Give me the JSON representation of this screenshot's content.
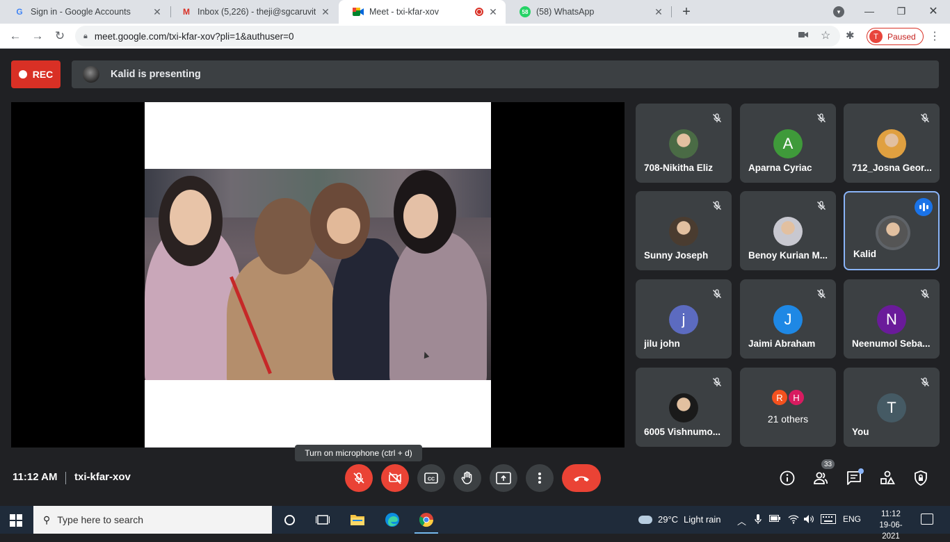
{
  "browser": {
    "tabs": [
      {
        "title": "Sign in - Google Accounts",
        "favicon": "G",
        "active": false
      },
      {
        "title": "Inbox (5,226) - theji@sgcaruvithu",
        "favicon": "M",
        "active": false
      },
      {
        "title": "Meet - txi-kfar-xov",
        "favicon": "meet",
        "active": true,
        "recording": true
      },
      {
        "title": "(58) WhatsApp",
        "favicon": "58",
        "active": false
      }
    ],
    "url": "meet.google.com/txi-kfar-xov?pli=1&authuser=0",
    "profile": {
      "initial": "T",
      "label": "Paused"
    }
  },
  "meet": {
    "rec_label": "REC",
    "presenting_text": "Kalid is presenting",
    "participants": [
      {
        "name": "708-Nikitha Eliz",
        "avatar": "photo",
        "color": "#4a6b45",
        "muted": true
      },
      {
        "name": "Aparna Cyriac",
        "avatar": "A",
        "color": "#3f9a3a",
        "muted": true
      },
      {
        "name": "712_Josna Geor...",
        "avatar": "photo",
        "color": "#e0a040",
        "muted": true
      },
      {
        "name": "Sunny Joseph",
        "avatar": "photo",
        "color": "#4a3c30",
        "muted": true
      },
      {
        "name": "Benoy Kurian M...",
        "avatar": "photo",
        "color": "#c8c8d0",
        "muted": true
      },
      {
        "name": "Kalid",
        "avatar": "photo",
        "color": "#555555",
        "muted": false,
        "speaking": true
      },
      {
        "name": "jilu john",
        "avatar": "j",
        "color": "#5c6bc0",
        "muted": true
      },
      {
        "name": "Jaimi Abraham",
        "avatar": "J",
        "color": "#1e88e5",
        "muted": true
      },
      {
        "name": "Neenumol Seba...",
        "avatar": "N",
        "color": "#6a1b9a",
        "muted": true
      },
      {
        "name": "6005 Vishnumo...",
        "avatar": "photo",
        "color": "#1a1a1a",
        "muted": true
      },
      {
        "name": "21 others",
        "avatar": "group",
        "muted": false,
        "minis": [
          {
            "letter": "R",
            "color": "#f4511e"
          },
          {
            "letter": "H",
            "color": "#d81b60"
          }
        ]
      },
      {
        "name": "You",
        "avatar": "T",
        "color": "#455a64",
        "muted": true
      }
    ],
    "tooltip": "Turn on microphone (ctrl + d)",
    "time": "11:12 AM",
    "meeting_code": "txi-kfar-xov",
    "people_count": "33"
  },
  "taskbar": {
    "search_placeholder": "Type here to search",
    "weather": {
      "temp": "29°C",
      "condition": "Light rain"
    },
    "language": "ENG",
    "clock_time": "11:12",
    "clock_date": "19-06-2021"
  }
}
